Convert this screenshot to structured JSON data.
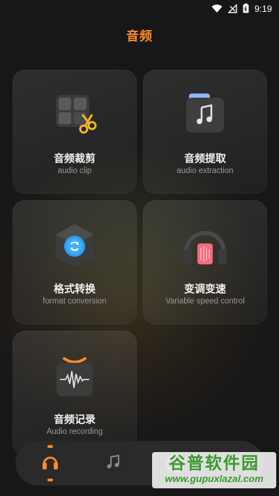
{
  "status_bar": {
    "time": "9:19",
    "icons": [
      "wifi-icon",
      "signal-icon",
      "battery-icon"
    ]
  },
  "header": {
    "title": "音频"
  },
  "cards": [
    {
      "title": "音频裁剪",
      "subtitle": "audio clip",
      "icon": "audio-clip-icon"
    },
    {
      "title": "音频提取",
      "subtitle": "audio extraction",
      "icon": "audio-extraction-icon"
    },
    {
      "title": "格式转换",
      "subtitle": "format conversion",
      "icon": "format-conversion-icon"
    },
    {
      "title": "变调变速",
      "subtitle": "Variable speed control",
      "icon": "variable-speed-icon"
    },
    {
      "title": "音频记录",
      "subtitle": "Audio recording",
      "icon": "audio-recording-icon"
    }
  ],
  "bottom_nav": {
    "items": [
      {
        "icon": "headphones-icon",
        "active": true
      },
      {
        "icon": "music-note-icon",
        "active": false
      },
      {
        "icon": "circle-icon",
        "active": false
      }
    ]
  },
  "watermark": {
    "main": "谷普软件园",
    "url": "www.gupuxlazal.com"
  },
  "colors": {
    "accent": "#ff8a2a",
    "background": "#171717",
    "card": "#2a2a2a",
    "watermark_green": "#3a9a2e"
  }
}
